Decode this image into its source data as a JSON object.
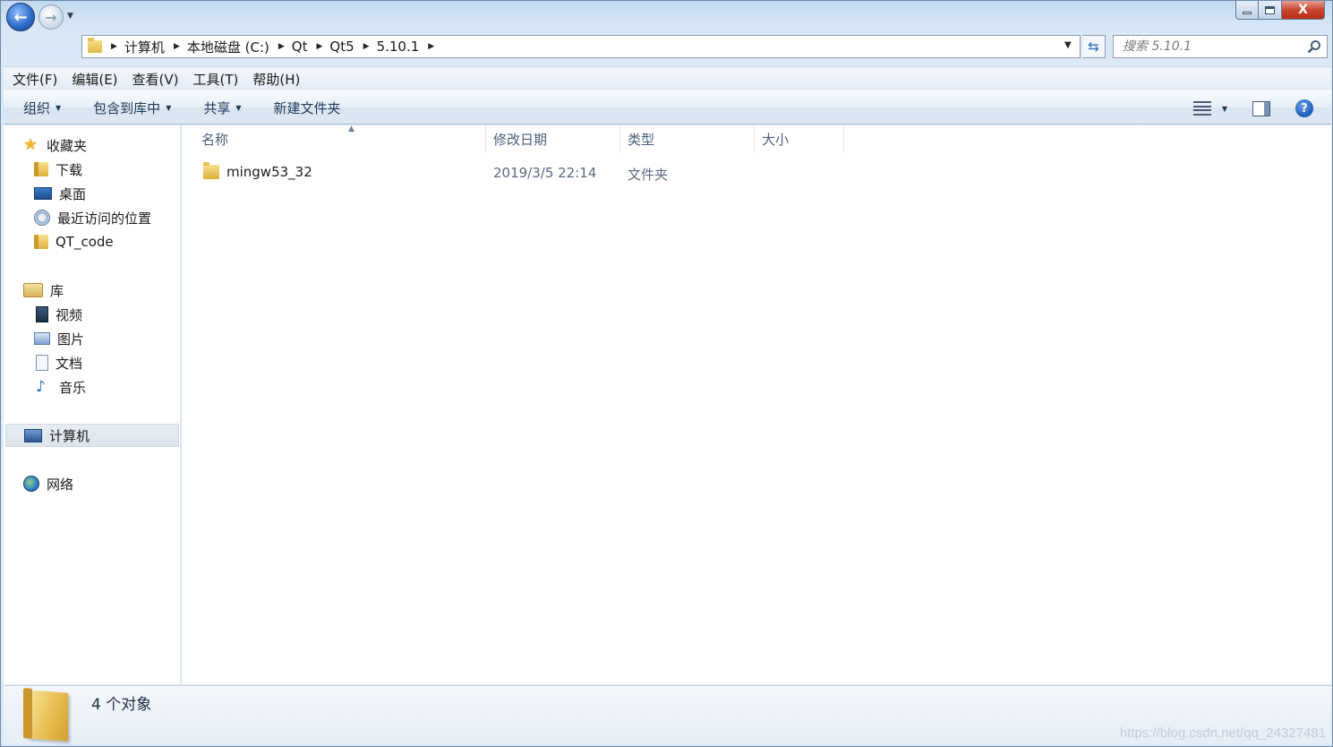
{
  "caption": {
    "close_glyph": "X"
  },
  "nav": {
    "back_glyph": "←",
    "forward_glyph": "→"
  },
  "address": {
    "crumbs": [
      "计算机",
      "本地磁盘 (C:)",
      "Qt",
      "Qt5",
      "5.10.1"
    ]
  },
  "search": {
    "placeholder": "搜索 5.10.1"
  },
  "menubar": {
    "items": [
      "文件(F)",
      "编辑(E)",
      "查看(V)",
      "工具(T)",
      "帮助(H)"
    ]
  },
  "cmdbar": {
    "organize": "组织",
    "include_library": "包含到库中",
    "share": "共享",
    "new_folder": "新建文件夹",
    "help_glyph": "?"
  },
  "navpane": {
    "favorites": "收藏夹",
    "favorites_items": [
      "下载",
      "桌面",
      "最近访问的位置",
      "QT_code"
    ],
    "libraries": "库",
    "library_items": [
      "视频",
      "图片",
      "文档",
      "音乐"
    ],
    "computer": "计算机",
    "network": "网络"
  },
  "columns": {
    "name": "名称",
    "date": "修改日期",
    "type": "类型",
    "size": "大小"
  },
  "files": [
    {
      "name": "mingw53_32",
      "date": "2019/3/5 22:14",
      "type": "文件夹",
      "size": ""
    }
  ],
  "status": {
    "count_text": "4 个对象"
  },
  "watermark": "https://blog.csdn.net/qq_24327481",
  "colors": {
    "accent": "#2a67c4",
    "folder": "#e1b844",
    "close": "#c7452f"
  }
}
